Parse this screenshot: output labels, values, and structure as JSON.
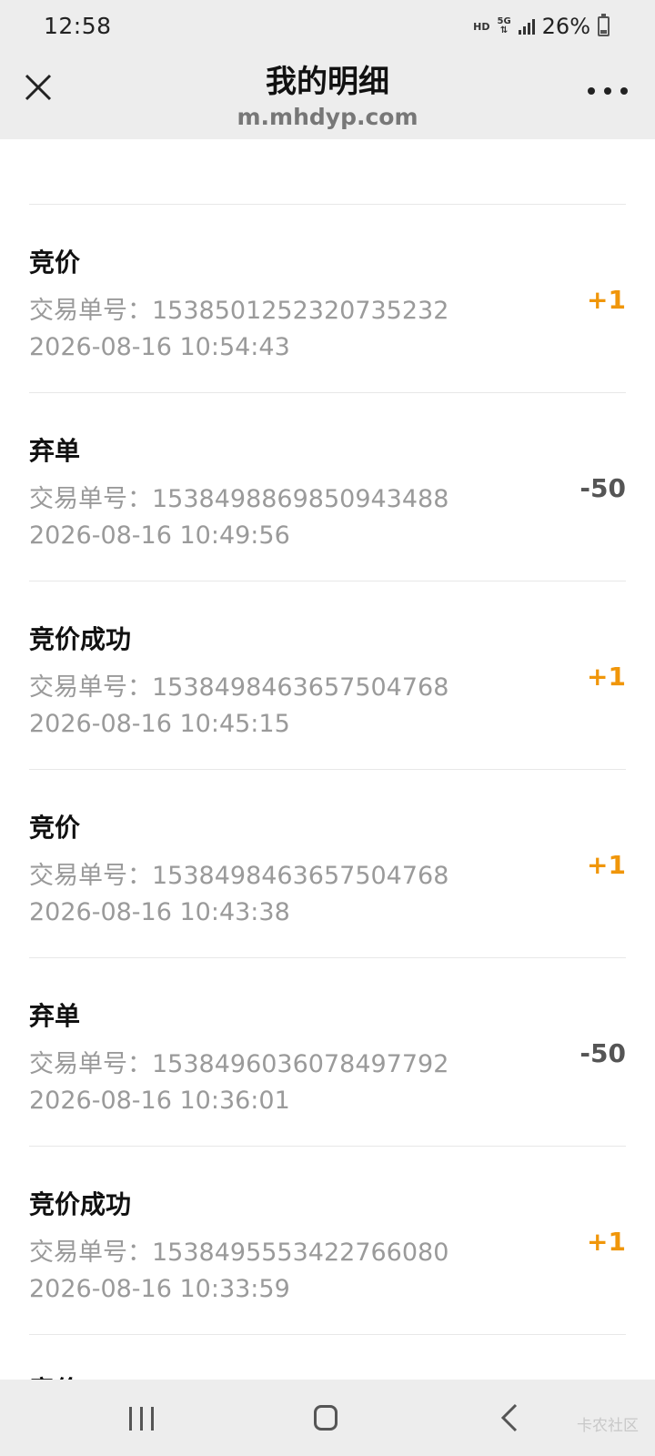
{
  "status_bar": {
    "time": "12:58",
    "hd": "HD",
    "network": "5G",
    "battery_percent": "26%",
    "battery_level": 0.26
  },
  "header": {
    "title": "我的明细",
    "url": "m.mhdyp.com",
    "close_icon": "close-icon",
    "more_icon": "more-icon"
  },
  "colors": {
    "positive": "#f0960a",
    "negative": "#555555",
    "muted_text": "#9a9a9a"
  },
  "transactions": [
    {
      "type": "竞价",
      "order": "交易单号：1538501252320735232",
      "time": "2026-08-16 10:54:43",
      "amount": "+1"
    },
    {
      "type": "弃单",
      "order": "交易单号：1538498869850943488",
      "time": "2026-08-16 10:49:56",
      "amount": "-50"
    },
    {
      "type": "竞价成功",
      "order": "交易单号：1538498463657504768",
      "time": "2026-08-16 10:45:15",
      "amount": "+1"
    },
    {
      "type": "竞价",
      "order": "交易单号：1538498463657504768",
      "time": "2026-08-16 10:43:38",
      "amount": "+1"
    },
    {
      "type": "弃单",
      "order": "交易单号：1538496036078497792",
      "time": "2026-08-16 10:36:01",
      "amount": "-50"
    },
    {
      "type": "竞价成功",
      "order": "交易单号：1538495553422766080",
      "time": "2026-08-16 10:33:59",
      "amount": "+1"
    }
  ],
  "partial_item": "竞价",
  "watermark": "卡农社区"
}
